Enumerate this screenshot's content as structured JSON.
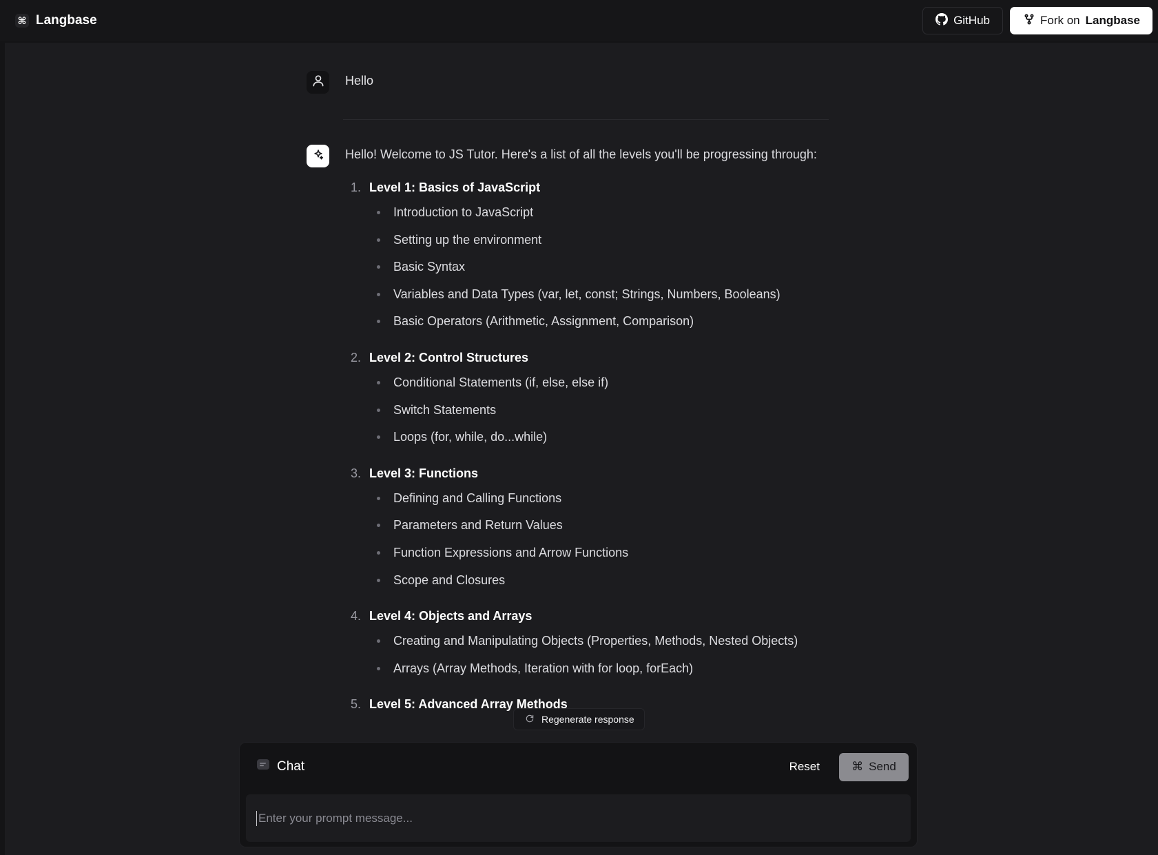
{
  "header": {
    "brand_icon": "⌘",
    "brand_name": "Langbase",
    "github_label": "GitHub",
    "fork_prefix": "Fork on",
    "fork_brand": "Langbase"
  },
  "conversation": {
    "user_message": "Hello",
    "assistant_intro": "Hello! Welcome to JS Tutor. Here's a list of all the levels you'll be progressing through:",
    "levels": [
      {
        "number": "1.",
        "title": "Level 1: Basics of JavaScript",
        "topics": [
          "Introduction to JavaScript",
          "Setting up the environment",
          "Basic Syntax",
          "Variables and Data Types (var, let, const; Strings, Numbers, Booleans)",
          "Basic Operators (Arithmetic, Assignment, Comparison)"
        ]
      },
      {
        "number": "2.",
        "title": "Level 2: Control Structures",
        "topics": [
          "Conditional Statements (if, else, else if)",
          "Switch Statements",
          "Loops (for, while, do...while)"
        ]
      },
      {
        "number": "3.",
        "title": "Level 3: Functions",
        "topics": [
          "Defining and Calling Functions",
          "Parameters and Return Values",
          "Function Expressions and Arrow Functions",
          "Scope and Closures"
        ]
      },
      {
        "number": "4.",
        "title": "Level 4: Objects and Arrays",
        "topics": [
          "Creating and Manipulating Objects (Properties, Methods, Nested Objects)",
          "Arrays (Array Methods, Iteration with for loop, forEach)"
        ]
      },
      {
        "number": "5.",
        "title": "Level 5: Advanced Array Methods",
        "topics": []
      }
    ]
  },
  "regenerate_label": "Regenerate response",
  "chat": {
    "label": "Chat",
    "reset_label": "Reset",
    "send_label": "Send",
    "send_icon": "⌘",
    "prompt_value": "",
    "prompt_placeholder": "Enter your prompt message..."
  }
}
